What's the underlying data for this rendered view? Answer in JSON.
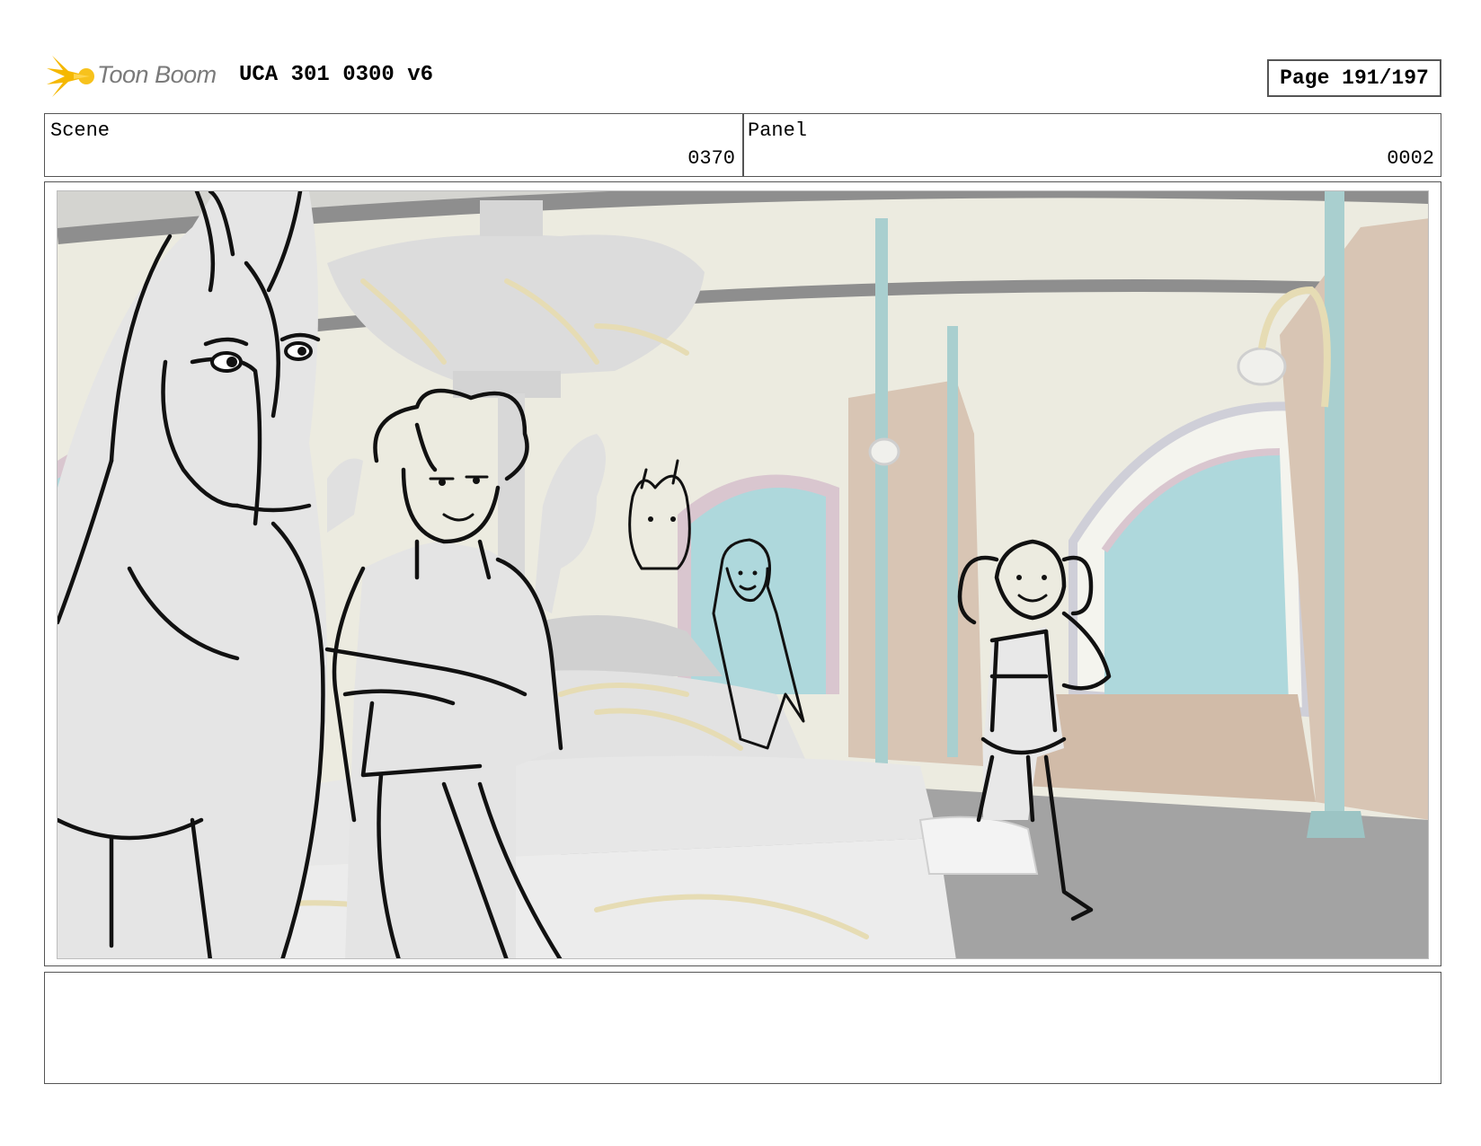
{
  "header": {
    "logo_text": "Toon Boom",
    "project_title": "UCA 301 0300 v6",
    "page_label": "Page 191/197"
  },
  "info": {
    "scene_label": "Scene",
    "scene_value": "0370",
    "panel_label": "Panel",
    "panel_value": "0002"
  },
  "notes": {
    "text": ""
  },
  "colors": {
    "border": "#555555",
    "logo_star": "#f5b800",
    "wall_cream": "#ecebe0",
    "pillar_teal": "#a9cfcf",
    "window_blue": "#aed8dc",
    "wood_beige": "#d8c5b4",
    "floor_gray": "#a3a3a3"
  }
}
